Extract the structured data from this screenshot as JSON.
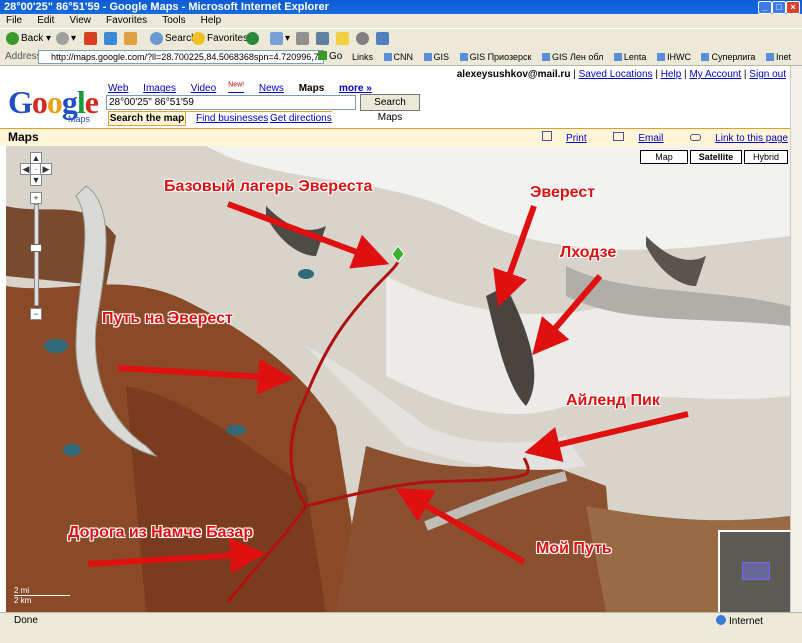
{
  "window": {
    "title": "28°00'25\" 86°51'59 - Google Maps - Microsoft Internet Explorer"
  },
  "menu": [
    "File",
    "Edit",
    "View",
    "Favorites",
    "Tools",
    "Help"
  ],
  "toolbar": {
    "back": "Back",
    "search": "Search",
    "favorites": "Favorites"
  },
  "address": {
    "label": "Address",
    "url": "http://maps.google.com/?ll=28.700225,84.5068368spn=4.720996,7.404785&t=h",
    "go": "Go"
  },
  "links": {
    "label": "Links",
    "items": [
      "CNN",
      "GIS",
      "GIS Приозерск",
      "GIS Лен обл",
      "Lenta",
      "IHWC",
      "Суперлига",
      "Inet"
    ]
  },
  "user": {
    "email": "alexeysushkov@mail.ru",
    "saved": "Saved Locations",
    "help": "Help",
    "account": "My Account",
    "signout": "Sign out"
  },
  "logo": {
    "g1": "G",
    "o1": "o",
    "o2": "o",
    "g2": "g",
    "l": "l",
    "e": "e",
    "sub": "Maps"
  },
  "tabs": {
    "web": "Web",
    "images": "Images",
    "video": "Video",
    "video_new": "New!",
    "news": "News",
    "maps": "Maps",
    "more": "more »"
  },
  "search": {
    "value": "28°00'25\" 86°51'59",
    "button": "Search Maps"
  },
  "subtabs": {
    "search_map": "Search the map",
    "businesses": "Find businesses",
    "directions": "Get directions"
  },
  "maps_header": {
    "title": "Maps",
    "print": "Print",
    "email": "Email",
    "link": "Link to this page"
  },
  "map_types": {
    "map": "Map",
    "satellite": "Satellite",
    "hybrid": "Hybrid"
  },
  "annotations": {
    "base_camp": "Базовый лагерь Эвереста",
    "everest": "Эверест",
    "lhotse": "Лходзе",
    "path_everest": "Путь на Эверест",
    "island_peak": "Айленд Пик",
    "road_namche": "Дорога из Намче Базар",
    "my_path": "Мой Путь"
  },
  "scale": {
    "top": "2 mi",
    "bottom": "2 km"
  },
  "status": {
    "left": "Done",
    "zone": "Internet"
  },
  "colors": {
    "accent": "#e01010",
    "title_bar": "#0a5bd6"
  }
}
